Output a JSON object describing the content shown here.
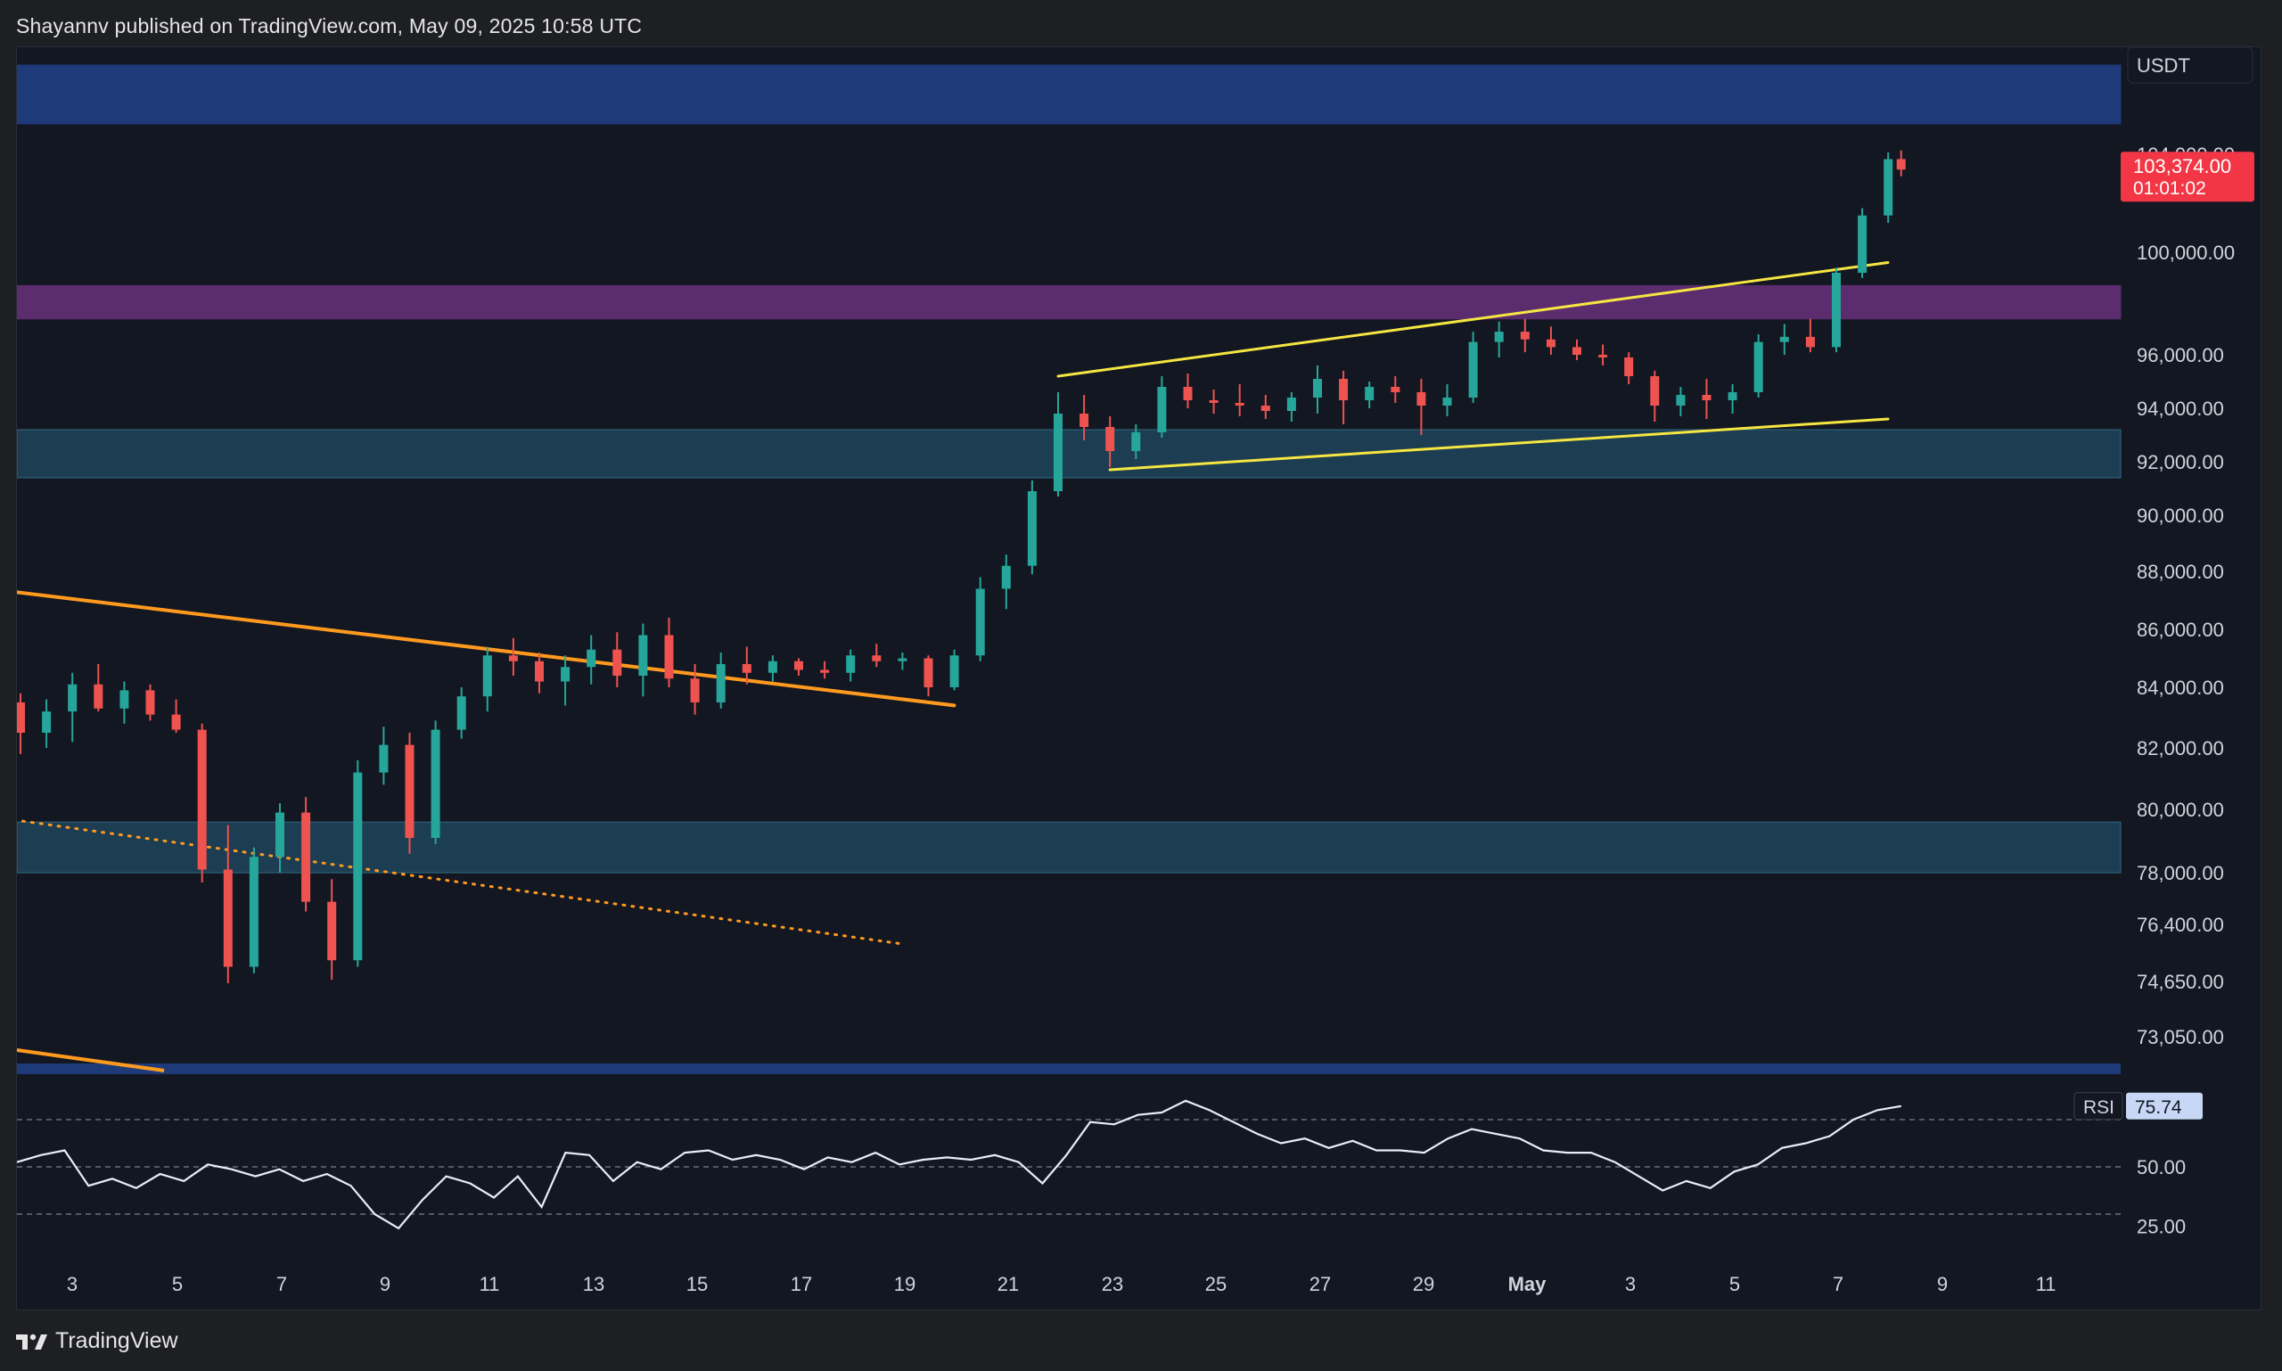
{
  "header": {
    "published_line": "Shayannv published on TradingView.com, May 09, 2025 10:58 UTC"
  },
  "footer": {
    "brand": "TradingView",
    "logo_icon": "tradingview-logo-icon"
  },
  "chart_data": [
    {
      "type": "candlestick",
      "currency": "USDT",
      "y_ticks": [
        "104,000.00",
        "100,000.00",
        "96,000.00",
        "94,000.00",
        "92,000.00",
        "90,000.00",
        "88,000.00",
        "86,000.00",
        "84,000.00",
        "82,000.00",
        "80,000.00",
        "78,000.00",
        "76,400.00",
        "74,650.00",
        "73,050.00"
      ],
      "x_ticks": [
        "3",
        "5",
        "7",
        "9",
        "11",
        "13",
        "15",
        "17",
        "19",
        "21",
        "23",
        "25",
        "27",
        "29",
        "May",
        "3",
        "5",
        "7",
        "9",
        "11"
      ],
      "last_price": {
        "value": "103,374.00",
        "countdown": "01:01:02",
        "color": "#f23645"
      },
      "colors": {
        "up": "#26a69a",
        "down": "#ef5350",
        "zone_blue": "#1e3a78",
        "zone_purple": "#5b2d6e",
        "zone_teal": "#1c3d52",
        "trendline_orange": "#ff9a1f",
        "channel_yellow": "#f5e642"
      },
      "zones": [
        {
          "name": "upper-supply-zone",
          "y_range": [
            105600,
            108700
          ]
        },
        {
          "name": "resistance-zone",
          "y_range": [
            97400,
            98700
          ]
        },
        {
          "name": "support-zone-upper",
          "y_range": [
            91400,
            93200
          ]
        },
        {
          "name": "support-zone-lower",
          "y_range": [
            78000,
            79600
          ]
        }
      ],
      "trendlines": [
        {
          "name": "orange-descending-line",
          "from": [
            "Apr 1",
            87700
          ],
          "to": [
            "Apr 20",
            83400
          ],
          "style": "solid"
        },
        {
          "name": "orange-dotted-line",
          "from": [
            "Apr 1",
            80100
          ],
          "to": [
            "Apr 19",
            75800
          ],
          "style": "dotted"
        },
        {
          "name": "channel-upper-line",
          "from": [
            "Apr 23",
            95200
          ],
          "to": [
            "May 8",
            99600
          ],
          "style": "solid"
        },
        {
          "name": "channel-lower-line",
          "from": [
            "Apr 24",
            91700
          ],
          "to": [
            "May 8",
            93600
          ],
          "style": "solid"
        }
      ],
      "series": [
        {
          "points": [
            [
              "Apr 1",
              84800,
              85300,
              84200,
              84400
            ],
            [
              "Apr 1.5",
              84400,
              87500,
              83800,
              86900
            ],
            [
              "Apr 2",
              86900,
              88500,
              82500,
              82800
            ],
            [
              "Apr 2.5",
              82800,
              83900,
              82300,
              83500
            ],
            [
              "Apr 3",
              83500,
              83800,
              81800,
              82500
            ],
            [
              "Apr 3.5",
              82500,
              83600,
              82000,
              83200
            ],
            [
              "Apr 4",
              83200,
              84500,
              82200,
              84100
            ],
            [
              "Apr 4.5",
              84100,
              84800,
              83200,
              83300
            ],
            [
              "Apr 5",
              83300,
              84200,
              82800,
              83900
            ],
            [
              "Apr 5.5",
              83900,
              84100,
              82900,
              83100
            ],
            [
              "Apr 6",
              83100,
              83600,
              82500,
              82600
            ],
            [
              "Apr 6.5",
              82600,
              82800,
              77700,
              78100
            ],
            [
              "Apr 7",
              78100,
              79500,
              74600,
              75100
            ],
            [
              "Apr 7.5",
              75100,
              78800,
              74900,
              78500
            ],
            [
              "Apr 8",
              78500,
              80200,
              78000,
              79900
            ],
            [
              "Apr 8.5",
              79900,
              80400,
              76800,
              77100
            ],
            [
              "Apr 9",
              77100,
              77800,
              74700,
              75300
            ],
            [
              "Apr 9.5",
              75300,
              81600,
              75100,
              81200
            ],
            [
              "Apr 10",
              81200,
              82700,
              80800,
              82100
            ],
            [
              "Apr 10.5",
              82100,
              82500,
              78600,
              79100
            ],
            [
              "Apr 11",
              79100,
              82900,
              78900,
              82600
            ],
            [
              "Apr 11.5",
              82600,
              84000,
              82300,
              83700
            ],
            [
              "Apr 12",
              83700,
              85400,
              83200,
              85100
            ],
            [
              "Apr 12.5",
              85100,
              85700,
              84400,
              84900
            ],
            [
              "Apr 13",
              84900,
              85200,
              83800,
              84200
            ],
            [
              "Apr 13.5",
              84200,
              85100,
              83400,
              84700
            ],
            [
              "Apr 14",
              84700,
              85800,
              84100,
              85300
            ],
            [
              "Apr 14.5",
              85300,
              85900,
              84000,
              84400
            ],
            [
              "Apr 15",
              84400,
              86200,
              83700,
              85800
            ],
            [
              "Apr 15.5",
              85800,
              86400,
              84000,
              84300
            ],
            [
              "Apr 16",
              84300,
              84800,
              83100,
              83500
            ],
            [
              "Apr 16.5",
              83500,
              85200,
              83300,
              84800
            ],
            [
              "Apr 17",
              84800,
              85400,
              84100,
              84500
            ],
            [
              "Apr 17.5",
              84500,
              85100,
              84200,
              84900
            ],
            [
              "Apr 18",
              84900,
              85000,
              84400,
              84600
            ],
            [
              "Apr 18.5",
              84600,
              84900,
              84300,
              84500
            ],
            [
              "Apr 19",
              84500,
              85300,
              84200,
              85100
            ],
            [
              "Apr 19.5",
              85100,
              85500,
              84700,
              84900
            ],
            [
              "Apr 20",
              84900,
              85200,
              84600,
              85000
            ],
            [
              "Apr 20.5",
              85000,
              85100,
              83700,
              84000
            ],
            [
              "Apr 21",
              84000,
              85300,
              83900,
              85100
            ],
            [
              "Apr 21.5",
              85100,
              87800,
              84900,
              87400
            ],
            [
              "Apr 22",
              87400,
              88600,
              86700,
              88200
            ],
            [
              "Apr 22.5",
              88200,
              91300,
              87900,
              90900
            ],
            [
              "Apr 23",
              90900,
              94600,
              90700,
              93800
            ],
            [
              "Apr 23.5",
              93800,
              94500,
              92800,
              93300
            ],
            [
              "Apr 24",
              93300,
              93700,
              91800,
              92400
            ],
            [
              "Apr 24.5",
              92400,
              93400,
              92100,
              93100
            ],
            [
              "Apr 25",
              93100,
              95200,
              92900,
              94800
            ],
            [
              "Apr 25.5",
              94800,
              95300,
              94000,
              94300
            ],
            [
              "Apr 26",
              94300,
              94700,
              93800,
              94200
            ],
            [
              "Apr 26.5",
              94200,
              94900,
              93700,
              94100
            ],
            [
              "Apr 27",
              94100,
              94500,
              93600,
              93900
            ],
            [
              "Apr 27.5",
              93900,
              94600,
              93500,
              94400
            ],
            [
              "Apr 28",
              94400,
              95600,
              93800,
              95100
            ],
            [
              "Apr 28.5",
              95100,
              95400,
              93400,
              94300
            ],
            [
              "Apr 29",
              94300,
              95000,
              94000,
              94800
            ],
            [
              "Apr 29.5",
              94800,
              95200,
              94200,
              94600
            ],
            [
              "Apr 30",
              94600,
              95100,
              93000,
              94100
            ],
            [
              "Apr 30.5",
              94100,
              94900,
              93700,
              94400
            ],
            [
              "May 1",
              94400,
              96900,
              94200,
              96500
            ],
            [
              "May 1.5",
              96500,
              97300,
              95900,
              96900
            ],
            [
              "May 2",
              96900,
              97400,
              96100,
              96600
            ],
            [
              "May 2.5",
              96600,
              97100,
              96000,
              96300
            ],
            [
              "May 3",
              96300,
              96600,
              95800,
              96000
            ],
            [
              "May 3.5",
              96000,
              96400,
              95600,
              95900
            ],
            [
              "May 4",
              95900,
              96100,
              94900,
              95200
            ],
            [
              "May 4.5",
              95200,
              95400,
              93500,
              94100
            ],
            [
              "May 5",
              94100,
              94800,
              93700,
              94500
            ],
            [
              "May 5.5",
              94500,
              95100,
              93600,
              94300
            ],
            [
              "May 6",
              94300,
              94900,
              93800,
              94600
            ],
            [
              "May 6.5",
              94600,
              96800,
              94400,
              96500
            ],
            [
              "May 7",
              96500,
              97200,
              96000,
              96700
            ],
            [
              "May 7.5",
              96700,
              97400,
              96100,
              96300
            ],
            [
              "May 8",
              96300,
              99400,
              96100,
              99200
            ],
            [
              "May 8.5",
              99200,
              101800,
              99000,
              101500
            ],
            [
              "May 9",
              101500,
              104100,
              101200,
              103800
            ],
            [
              "May 9.25",
              103800,
              104200,
              103100,
              103374
            ]
          ]
        }
      ]
    },
    {
      "type": "line",
      "indicator": "RSI",
      "value_label": "75.74",
      "y_ticks": [
        "50.00",
        "25.00"
      ],
      "ylim": [
        10,
        90
      ],
      "series": [
        {
          "name": "RSI",
          "values": [
            52,
            55,
            57,
            42,
            45,
            41,
            47,
            44,
            51,
            49,
            46,
            49,
            44,
            47,
            42,
            30,
            24,
            36,
            46,
            43,
            37,
            46,
            33,
            56,
            55,
            44,
            52,
            49,
            56,
            57,
            53,
            55,
            53,
            49,
            54,
            52,
            56,
            51,
            53,
            54,
            53,
            55,
            52,
            43,
            55,
            69,
            68,
            72,
            73,
            78,
            74,
            69,
            64,
            60,
            62,
            58,
            61,
            57,
            57,
            56,
            62,
            66,
            64,
            62,
            57,
            56,
            56,
            52,
            46,
            40,
            44,
            41,
            48,
            51,
            58,
            60,
            63,
            70,
            74,
            75.74
          ]
        }
      ]
    }
  ]
}
